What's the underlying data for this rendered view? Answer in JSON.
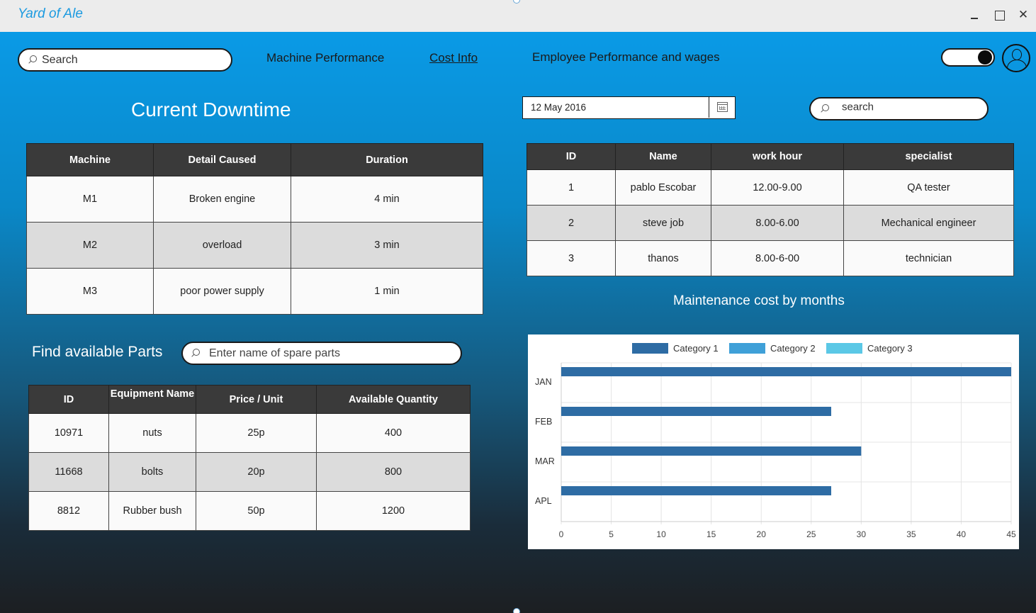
{
  "app": {
    "title": "Yard of Ale"
  },
  "window_controls": {
    "close": "✕"
  },
  "nav": {
    "search_placeholder": "Search",
    "links": [
      "Machine Performance",
      "Cost Info",
      "Employee Performance and wages"
    ],
    "active": "Cost Info",
    "toggle_on": true
  },
  "downtime": {
    "title": "Current Downtime",
    "columns": [
      "Machine",
      "Detail Caused",
      "Duration"
    ],
    "rows": [
      [
        "M1",
        "Broken engine",
        "4 min"
      ],
      [
        "M2",
        "overload",
        "3 min"
      ],
      [
        "M3",
        "poor power supply",
        "1 min"
      ]
    ]
  },
  "parts": {
    "title": "Find available Parts",
    "search_placeholder": "Enter name of spare parts",
    "columns": [
      "ID",
      "Equipment Name",
      "Price / Unit",
      "Available Quantity"
    ],
    "rows": [
      [
        "10971",
        "nuts",
        "25p",
        "400"
      ],
      [
        "11668",
        "bolts",
        "20p",
        "800"
      ],
      [
        "8812",
        "Rubber bush",
        "50p",
        "1200"
      ]
    ]
  },
  "employees": {
    "date_value": "12 May 2016",
    "search_placeholder": "search",
    "columns": [
      "ID",
      "Name",
      "work hour",
      "specialist"
    ],
    "rows": [
      [
        "1",
        "pablo Escobar",
        "12.00-9.00",
        "QA tester"
      ],
      [
        "2",
        "steve job",
        "8.00-6.00",
        "Mechanical engineer"
      ],
      [
        "3",
        "thanos",
        "8.00-6-00",
        "technician"
      ]
    ]
  },
  "chart_data": {
    "type": "bar",
    "orientation": "horizontal",
    "title": "Maintenance cost by months",
    "categories": [
      "JAN",
      "FEB",
      "MAR",
      "APL"
    ],
    "series": [
      {
        "name": "Category 1",
        "color": "#2e6ca4",
        "values": [
          45,
          27,
          30,
          27
        ]
      },
      {
        "name": "Category 2",
        "color": "#3fa0d8",
        "values": [
          0,
          0,
          0,
          0
        ]
      },
      {
        "name": "Category 3",
        "color": "#5bc8e6",
        "values": [
          0,
          0,
          0,
          0
        ]
      }
    ],
    "xlim": [
      0,
      45
    ],
    "xticks": [
      0,
      5,
      10,
      15,
      20,
      25,
      30,
      35,
      40,
      45
    ],
    "legend": "top",
    "grid": true
  }
}
